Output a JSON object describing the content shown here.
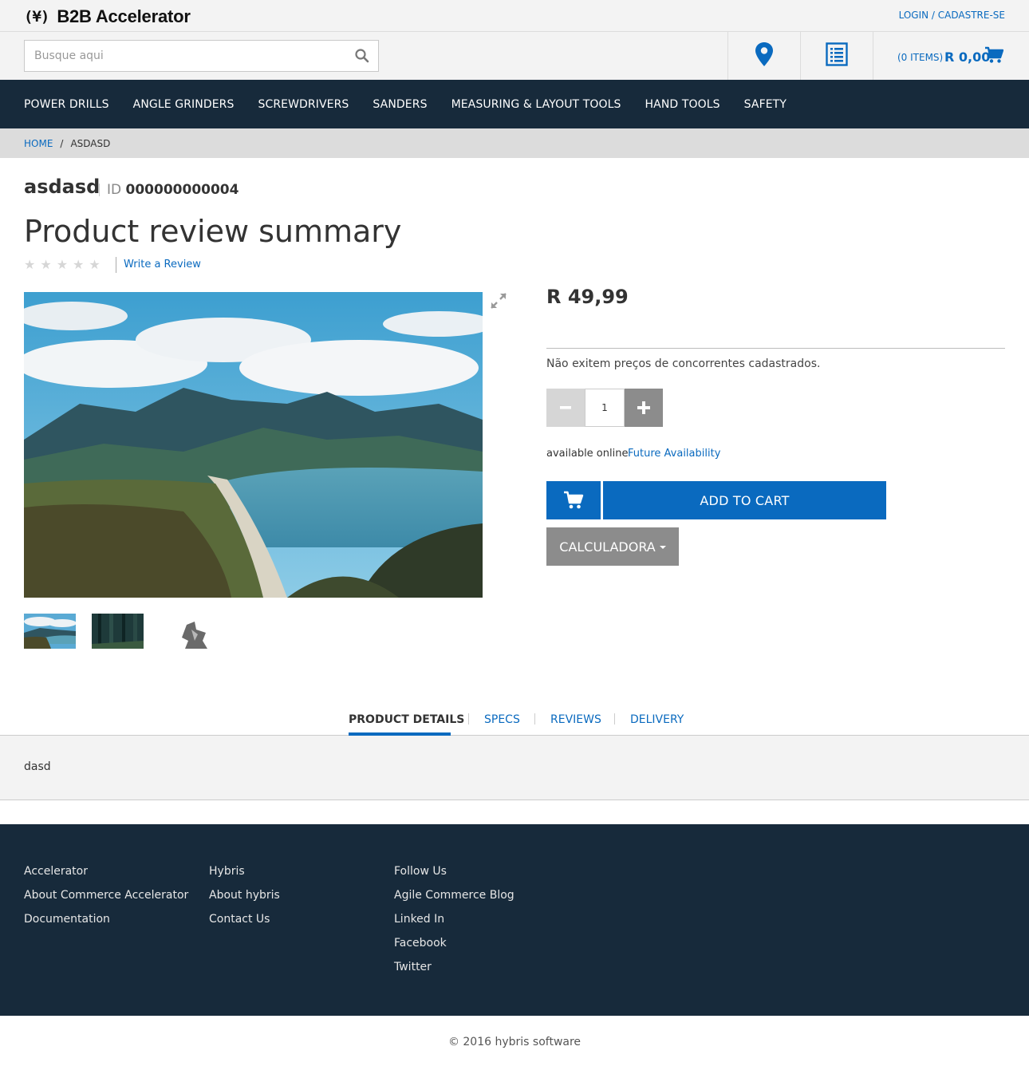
{
  "header": {
    "logo_mark": "(¥)",
    "logo_text": "B2B Accelerator",
    "login_label": "LOGIN / CADASTRE-SE",
    "search_placeholder": "Busque aqui",
    "cart_count": "(0 ITEMS)",
    "cart_total": "R 0,00"
  },
  "nav": {
    "items": [
      "POWER DRILLS",
      "ANGLE GRINDERS",
      "SCREWDRIVERS",
      "SANDERS",
      "MEASURING & LAYOUT TOOLS",
      "HAND TOOLS",
      "SAFETY"
    ]
  },
  "breadcrumb": {
    "home": "HOME",
    "separator": "/",
    "current": "ASDASD"
  },
  "product": {
    "name": "asdasd",
    "id_label": "ID",
    "id_value": "000000000004",
    "review_title": "Product review summary",
    "rating": 0,
    "rating_max": 5,
    "write_review": "Write a Review",
    "price": "R 49,99",
    "competitors_text": "Não exitem preços de concorrentes cadastrados.",
    "quantity": "1",
    "availability": "available online",
    "future_availability": "Future Availability",
    "add_to_cart": "ADD TO CART",
    "calculator": "CALCULADORA"
  },
  "tabs": {
    "items": [
      "PRODUCT DETAILS",
      "SPECS",
      "REVIEWS",
      "DELIVERY"
    ],
    "active": "PRODUCT DETAILS",
    "details_text": "dasd"
  },
  "footer": {
    "columns": [
      {
        "heading": "Accelerator",
        "links": [
          "About Commerce Accelerator",
          "Documentation"
        ]
      },
      {
        "heading": "Hybris",
        "links": [
          "About hybris",
          "Contact Us"
        ]
      },
      {
        "heading": "Follow Us",
        "links": [
          "Agile Commerce Blog",
          "Linked In",
          "Facebook",
          "Twitter"
        ]
      }
    ],
    "copyright": "© 2016 hybris software"
  },
  "colors": {
    "accent": "#0a6abf",
    "nav_bg": "#172a3b",
    "topbar_bg": "#f3f3f3",
    "breadcrumb_bg": "#dcdcdc"
  },
  "icons": {
    "search": "search-icon",
    "store_locator": "map-marker-icon",
    "quick_order": "list-icon",
    "cart": "cart-icon",
    "zoom": "expand-icon",
    "minus": "minus-icon",
    "plus": "plus-icon"
  }
}
